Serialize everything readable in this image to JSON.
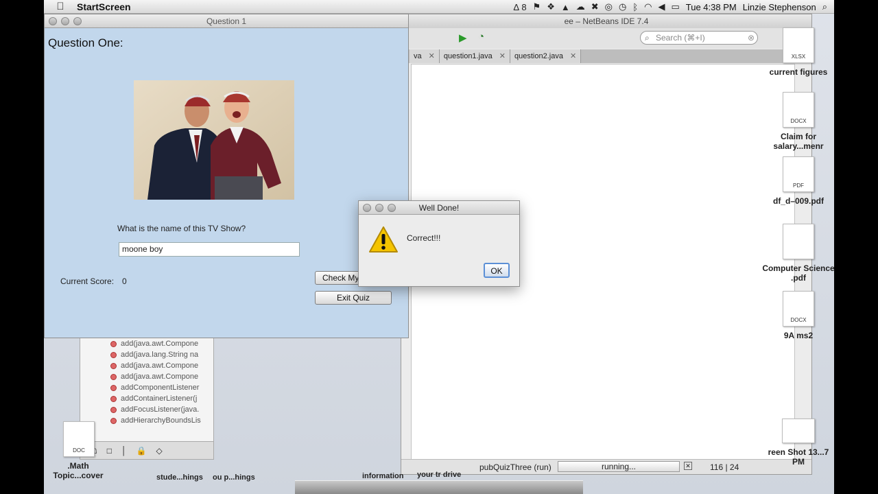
{
  "menubar": {
    "app_name": "StartScreen",
    "adobe_badge": "8",
    "clock": "Tue 4:38 PM",
    "user": "Linzie Stephenson"
  },
  "netbeans": {
    "title": "ee – NetBeans IDE 7.4",
    "search_placeholder": "Search (⌘+I)",
    "tabs": [
      {
        "label": "va"
      },
      {
        "label": "question1.java"
      },
      {
        "label": "question2.java"
      }
    ],
    "status_run": "pubQuizThree (run)",
    "status_progress": "running...",
    "status_position": "116 | 24"
  },
  "navigator": {
    "items": [
      "add(java.awt.Compone",
      "add(java.lang.String na",
      "add(java.awt.Compone",
      "add(java.awt.Compone",
      "addComponentListener",
      "addContainerListener(j",
      "addFocusListener(java.",
      "addHierarchyBoundsLis"
    ]
  },
  "desktop": {
    "icons": [
      {
        "badge": "XLSX",
        "label": "current figures"
      },
      {
        "badge": "DOCX",
        "label": "Claim for salary...menr"
      },
      {
        "badge": "PDF",
        "label": "df_d–009.pdf"
      },
      {
        "badge": "",
        "label": "Computer Science .pdf"
      },
      {
        "badge": "DOCX",
        "label": "9A ms2"
      },
      {
        "badge": "",
        "label": "reen Shot 13...7 PM"
      }
    ],
    "left_icon_label": ".Math Topic...cover",
    "dock_labels": [
      "stude...hings",
      "ou p...hings",
      "information",
      "your tr drive"
    ]
  },
  "quiz": {
    "window_title": "Question 1",
    "heading": "Question One:",
    "question": "What is the name of this TV Show?",
    "answer_value": "moone boy",
    "score_label": "Current Score:",
    "score_value": "0",
    "check_button": "Check My",
    "exit_button": "Exit Quiz"
  },
  "dialog": {
    "title": "Well Done!",
    "message": "Correct!!!",
    "ok_label": "OK",
    "icon": "warning-icon"
  }
}
